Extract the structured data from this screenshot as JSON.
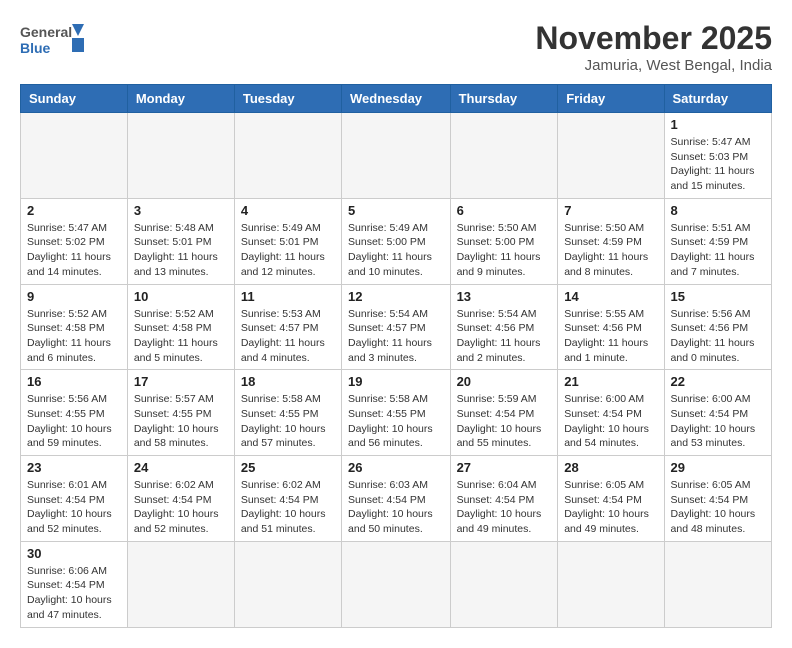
{
  "logo": {
    "text_general": "General",
    "text_blue": "Blue"
  },
  "title": "November 2025",
  "location": "Jamuria, West Bengal, India",
  "weekdays": [
    "Sunday",
    "Monday",
    "Tuesday",
    "Wednesday",
    "Thursday",
    "Friday",
    "Saturday"
  ],
  "weeks": [
    [
      {
        "day": "",
        "info": ""
      },
      {
        "day": "",
        "info": ""
      },
      {
        "day": "",
        "info": ""
      },
      {
        "day": "",
        "info": ""
      },
      {
        "day": "",
        "info": ""
      },
      {
        "day": "",
        "info": ""
      },
      {
        "day": "1",
        "info": "Sunrise: 5:47 AM\nSunset: 5:03 PM\nDaylight: 11 hours and 15 minutes."
      }
    ],
    [
      {
        "day": "2",
        "info": "Sunrise: 5:47 AM\nSunset: 5:02 PM\nDaylight: 11 hours and 14 minutes."
      },
      {
        "day": "3",
        "info": "Sunrise: 5:48 AM\nSunset: 5:01 PM\nDaylight: 11 hours and 13 minutes."
      },
      {
        "day": "4",
        "info": "Sunrise: 5:49 AM\nSunset: 5:01 PM\nDaylight: 11 hours and 12 minutes."
      },
      {
        "day": "5",
        "info": "Sunrise: 5:49 AM\nSunset: 5:00 PM\nDaylight: 11 hours and 10 minutes."
      },
      {
        "day": "6",
        "info": "Sunrise: 5:50 AM\nSunset: 5:00 PM\nDaylight: 11 hours and 9 minutes."
      },
      {
        "day": "7",
        "info": "Sunrise: 5:50 AM\nSunset: 4:59 PM\nDaylight: 11 hours and 8 minutes."
      },
      {
        "day": "8",
        "info": "Sunrise: 5:51 AM\nSunset: 4:59 PM\nDaylight: 11 hours and 7 minutes."
      }
    ],
    [
      {
        "day": "9",
        "info": "Sunrise: 5:52 AM\nSunset: 4:58 PM\nDaylight: 11 hours and 6 minutes."
      },
      {
        "day": "10",
        "info": "Sunrise: 5:52 AM\nSunset: 4:58 PM\nDaylight: 11 hours and 5 minutes."
      },
      {
        "day": "11",
        "info": "Sunrise: 5:53 AM\nSunset: 4:57 PM\nDaylight: 11 hours and 4 minutes."
      },
      {
        "day": "12",
        "info": "Sunrise: 5:54 AM\nSunset: 4:57 PM\nDaylight: 11 hours and 3 minutes."
      },
      {
        "day": "13",
        "info": "Sunrise: 5:54 AM\nSunset: 4:56 PM\nDaylight: 11 hours and 2 minutes."
      },
      {
        "day": "14",
        "info": "Sunrise: 5:55 AM\nSunset: 4:56 PM\nDaylight: 11 hours and 1 minute."
      },
      {
        "day": "15",
        "info": "Sunrise: 5:56 AM\nSunset: 4:56 PM\nDaylight: 11 hours and 0 minutes."
      }
    ],
    [
      {
        "day": "16",
        "info": "Sunrise: 5:56 AM\nSunset: 4:55 PM\nDaylight: 10 hours and 59 minutes."
      },
      {
        "day": "17",
        "info": "Sunrise: 5:57 AM\nSunset: 4:55 PM\nDaylight: 10 hours and 58 minutes."
      },
      {
        "day": "18",
        "info": "Sunrise: 5:58 AM\nSunset: 4:55 PM\nDaylight: 10 hours and 57 minutes."
      },
      {
        "day": "19",
        "info": "Sunrise: 5:58 AM\nSunset: 4:55 PM\nDaylight: 10 hours and 56 minutes."
      },
      {
        "day": "20",
        "info": "Sunrise: 5:59 AM\nSunset: 4:54 PM\nDaylight: 10 hours and 55 minutes."
      },
      {
        "day": "21",
        "info": "Sunrise: 6:00 AM\nSunset: 4:54 PM\nDaylight: 10 hours and 54 minutes."
      },
      {
        "day": "22",
        "info": "Sunrise: 6:00 AM\nSunset: 4:54 PM\nDaylight: 10 hours and 53 minutes."
      }
    ],
    [
      {
        "day": "23",
        "info": "Sunrise: 6:01 AM\nSunset: 4:54 PM\nDaylight: 10 hours and 52 minutes."
      },
      {
        "day": "24",
        "info": "Sunrise: 6:02 AM\nSunset: 4:54 PM\nDaylight: 10 hours and 52 minutes."
      },
      {
        "day": "25",
        "info": "Sunrise: 6:02 AM\nSunset: 4:54 PM\nDaylight: 10 hours and 51 minutes."
      },
      {
        "day": "26",
        "info": "Sunrise: 6:03 AM\nSunset: 4:54 PM\nDaylight: 10 hours and 50 minutes."
      },
      {
        "day": "27",
        "info": "Sunrise: 6:04 AM\nSunset: 4:54 PM\nDaylight: 10 hours and 49 minutes."
      },
      {
        "day": "28",
        "info": "Sunrise: 6:05 AM\nSunset: 4:54 PM\nDaylight: 10 hours and 49 minutes."
      },
      {
        "day": "29",
        "info": "Sunrise: 6:05 AM\nSunset: 4:54 PM\nDaylight: 10 hours and 48 minutes."
      }
    ],
    [
      {
        "day": "30",
        "info": "Sunrise: 6:06 AM\nSunset: 4:54 PM\nDaylight: 10 hours and 47 minutes."
      },
      {
        "day": "",
        "info": ""
      },
      {
        "day": "",
        "info": ""
      },
      {
        "day": "",
        "info": ""
      },
      {
        "day": "",
        "info": ""
      },
      {
        "day": "",
        "info": ""
      },
      {
        "day": "",
        "info": ""
      }
    ]
  ]
}
